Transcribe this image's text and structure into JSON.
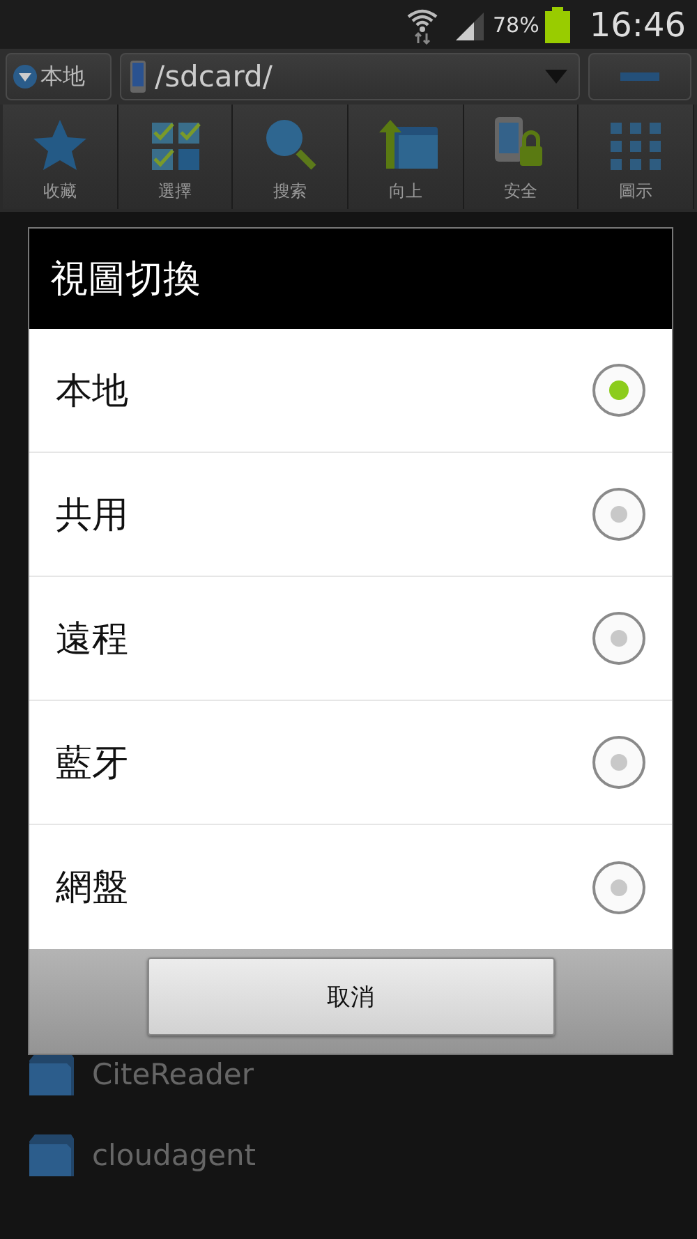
{
  "status_bar": {
    "battery": "78%",
    "time": "16:46"
  },
  "path_bar": {
    "location": "本地",
    "path": "/sdcard/"
  },
  "toolbar": [
    {
      "label": "收藏"
    },
    {
      "label": "選擇"
    },
    {
      "label": "搜索"
    },
    {
      "label": "向上"
    },
    {
      "label": "安全"
    },
    {
      "label": "圖示"
    }
  ],
  "files": [
    "CiteReader",
    "cloudagent"
  ],
  "dialog": {
    "title": "視圖切換",
    "options": [
      {
        "label": "本地",
        "selected": true
      },
      {
        "label": "共用",
        "selected": false
      },
      {
        "label": "遠程",
        "selected": false
      },
      {
        "label": "藍牙",
        "selected": false
      },
      {
        "label": "網盤",
        "selected": false
      }
    ],
    "cancel": "取消"
  }
}
